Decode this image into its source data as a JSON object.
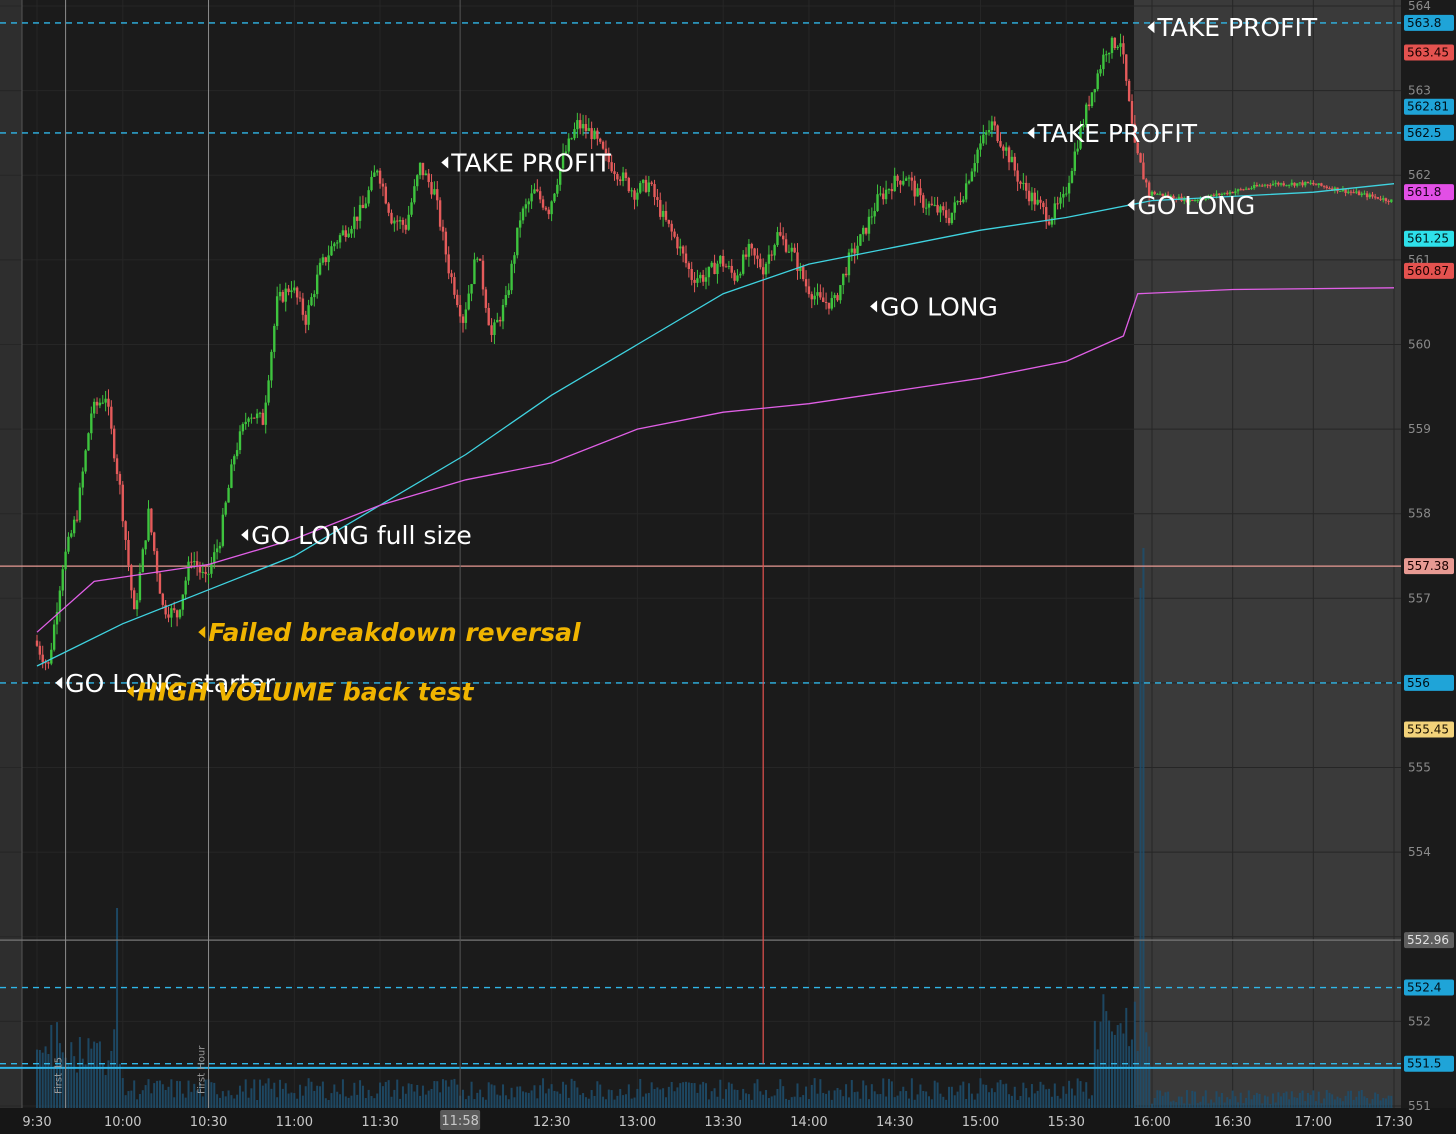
{
  "chart_data": {
    "type": "candlestick",
    "ylim": [
      551,
      564
    ],
    "y_ticks": [
      551,
      552,
      553,
      554,
      555,
      556,
      557,
      558,
      559,
      560,
      561,
      562,
      563,
      564
    ],
    "x_tick_labels": [
      "9:30",
      "10:00",
      "10:30",
      "11:00",
      "11:30",
      "12:30",
      "13:00",
      "13:30",
      "14:00",
      "14:30",
      "15:00",
      "15:30",
      "16:00",
      "16:30",
      "17:00",
      "17:30"
    ],
    "cursor_time_label": "11:58",
    "price_levels": [
      {
        "value": 563.8,
        "label": "563.8",
        "style": "dashed",
        "color": "#2fb6e8"
      },
      {
        "value": 562.5,
        "label": "562.5",
        "style": "dashed",
        "color": "#2fb6e8"
      },
      {
        "value": 557.38,
        "label": "557.38",
        "style": "solid",
        "color": "#e79a93"
      },
      {
        "value": 556,
        "label": "556",
        "style": "dashed",
        "color": "#2fb6e8"
      },
      {
        "value": 552.96,
        "label": "552.96",
        "style": "solid",
        "color": "#777777"
      },
      {
        "value": 552.4,
        "label": "552.4",
        "style": "dashed",
        "color": "#2fb6e8"
      },
      {
        "value": 551.5,
        "label": "551.5",
        "style": "dashed",
        "color": "#2fb6e8"
      }
    ],
    "price_badges": [
      {
        "value": 563.8,
        "label": "563.8",
        "bg": "#1fa4d8",
        "fg": "#001018"
      },
      {
        "value": 563.45,
        "label": "563.45",
        "bg": "#e4524f",
        "fg": "#1a0000"
      },
      {
        "value": 562.81,
        "label": "562.81",
        "bg": "#1fa4d8",
        "fg": "#001018"
      },
      {
        "value": 562.5,
        "label": "562.5",
        "bg": "#1fa4d8",
        "fg": "#001018"
      },
      {
        "value": 561.8,
        "label": "561.8",
        "bg": "#e24fe6",
        "fg": "#1a001a"
      },
      {
        "value": 561.25,
        "label": "561.25",
        "bg": "#2ee0ea",
        "fg": "#00181a"
      },
      {
        "value": 560.87,
        "label": "560.87",
        "bg": "#e4524f",
        "fg": "#1a0000"
      },
      {
        "value": 557.38,
        "label": "557.38",
        "bg": "#e79a93",
        "fg": "#1a0000"
      },
      {
        "value": 556,
        "label": "556",
        "bg": "#1fa4d8",
        "fg": "#001018"
      },
      {
        "value": 555.45,
        "label": "555.45",
        "bg": "#f2d27a",
        "fg": "#1a1000"
      },
      {
        "value": 552.96,
        "label": "552.96",
        "bg": "#5e5e5e",
        "fg": "#e0e0e0"
      },
      {
        "value": 552.4,
        "label": "552.4",
        "bg": "#1fa4d8",
        "fg": "#001018"
      },
      {
        "value": 551.5,
        "label": "551.5",
        "bg": "#1fa4d8",
        "fg": "#001018"
      }
    ],
    "price_path": [
      [
        "9:30",
        556.5
      ],
      [
        "9:35",
        556.2
      ],
      [
        "9:40",
        557.4
      ],
      [
        "9:45",
        558.0
      ],
      [
        "9:50",
        559.2
      ],
      [
        "9:55",
        559.4
      ],
      [
        "10:00",
        558.3
      ],
      [
        "10:05",
        556.8
      ],
      [
        "10:10",
        558.0
      ],
      [
        "10:15",
        556.9
      ],
      [
        "10:20",
        556.8
      ],
      [
        "10:25",
        557.5
      ],
      [
        "10:30",
        557.2
      ],
      [
        "10:35",
        557.7
      ],
      [
        "10:40",
        558.7
      ],
      [
        "10:45",
        559.2
      ],
      [
        "10:50",
        559.1
      ],
      [
        "10:55",
        560.5
      ],
      [
        "11:00",
        560.7
      ],
      [
        "11:05",
        560.3
      ],
      [
        "11:10",
        560.9
      ],
      [
        "11:15",
        561.2
      ],
      [
        "11:20",
        561.4
      ],
      [
        "11:25",
        561.6
      ],
      [
        "11:30",
        562.1
      ],
      [
        "11:35",
        561.5
      ],
      [
        "11:40",
        561.4
      ],
      [
        "11:45",
        562.1
      ],
      [
        "11:50",
        561.8
      ],
      [
        "11:55",
        560.9
      ],
      [
        "12:00",
        560.3
      ],
      [
        "12:05",
        561.1
      ],
      [
        "12:10",
        560.1
      ],
      [
        "12:15",
        560.5
      ],
      [
        "12:20",
        561.5
      ],
      [
        "12:25",
        561.8
      ],
      [
        "12:30",
        561.6
      ],
      [
        "12:35",
        562.2
      ],
      [
        "12:40",
        562.6
      ],
      [
        "12:45",
        562.5
      ],
      [
        "12:50",
        562.2
      ],
      [
        "12:55",
        562.0
      ],
      [
        "13:00",
        561.8
      ],
      [
        "13:05",
        561.9
      ],
      [
        "13:10",
        561.5
      ],
      [
        "13:15",
        561.2
      ],
      [
        "13:20",
        560.8
      ],
      [
        "13:25",
        560.8
      ],
      [
        "13:30",
        561.0
      ],
      [
        "13:35",
        560.8
      ],
      [
        "13:40",
        561.1
      ],
      [
        "13:45",
        560.9
      ],
      [
        "13:50",
        561.3
      ],
      [
        "13:55",
        561.1
      ],
      [
        "14:00",
        560.7
      ],
      [
        "14:05",
        560.5
      ],
      [
        "14:10",
        560.5
      ],
      [
        "14:15",
        561.0
      ],
      [
        "14:20",
        561.3
      ],
      [
        "14:25",
        561.7
      ],
      [
        "14:30",
        561.9
      ],
      [
        "14:35",
        562.0
      ],
      [
        "14:40",
        561.7
      ],
      [
        "14:45",
        561.6
      ],
      [
        "14:50",
        561.5
      ],
      [
        "14:55",
        561.8
      ],
      [
        "15:00",
        562.3
      ],
      [
        "15:05",
        562.6
      ],
      [
        "15:10",
        562.3
      ],
      [
        "15:15",
        561.9
      ],
      [
        "15:20",
        561.7
      ],
      [
        "15:25",
        561.5
      ],
      [
        "15:30",
        561.7
      ],
      [
        "15:35",
        562.4
      ],
      [
        "15:40",
        563.0
      ],
      [
        "15:45",
        563.5
      ],
      [
        "15:50",
        563.6
      ],
      [
        "15:55",
        562.3
      ],
      [
        "16:00",
        561.8
      ],
      [
        "16:15",
        561.7
      ],
      [
        "16:30",
        561.8
      ],
      [
        "16:45",
        561.9
      ],
      [
        "17:00",
        561.9
      ],
      [
        "17:15",
        561.8
      ],
      [
        "17:30",
        561.7
      ]
    ],
    "moving_average_cyan": [
      [
        "9:30",
        556.2
      ],
      [
        "10:00",
        556.7
      ],
      [
        "10:30",
        557.1
      ],
      [
        "11:00",
        557.5
      ],
      [
        "11:30",
        558.1
      ],
      [
        "12:00",
        558.7
      ],
      [
        "12:30",
        559.4
      ],
      [
        "13:00",
        560.0
      ],
      [
        "13:30",
        560.6
      ],
      [
        "14:00",
        560.95
      ],
      [
        "14:30",
        561.15
      ],
      [
        "15:00",
        561.35
      ],
      [
        "15:30",
        561.5
      ],
      [
        "16:00",
        561.7
      ],
      [
        "16:30",
        561.75
      ],
      [
        "17:00",
        561.8
      ],
      [
        "17:30",
        561.9
      ]
    ],
    "vwap_magenta": [
      [
        "9:30",
        556.6
      ],
      [
        "9:50",
        557.2
      ],
      [
        "10:10",
        557.3
      ],
      [
        "10:30",
        557.4
      ],
      [
        "11:00",
        557.7
      ],
      [
        "11:30",
        558.1
      ],
      [
        "12:00",
        558.4
      ],
      [
        "12:30",
        558.6
      ],
      [
        "13:00",
        559.0
      ],
      [
        "13:30",
        559.2
      ],
      [
        "14:00",
        559.3
      ],
      [
        "14:30",
        559.45
      ],
      [
        "15:00",
        559.6
      ],
      [
        "15:30",
        559.8
      ],
      [
        "15:50",
        560.1
      ],
      [
        "15:55",
        560.6
      ],
      [
        "16:30",
        560.65
      ],
      [
        "17:30",
        560.67
      ]
    ],
    "annotations": [
      {
        "text": "GO LONG starter",
        "color": "white",
        "time": "9:35",
        "price": 556.0
      },
      {
        "text": "HIGH VOLUME back test",
        "color": "gold",
        "time": "10:00",
        "price": 555.9
      },
      {
        "text": "Failed breakdown reversal",
        "color": "gold",
        "time": "10:25",
        "price": 556.6
      },
      {
        "text": "GO LONG full size",
        "color": "white",
        "time": "10:40",
        "price": 557.75
      },
      {
        "text": "TAKE PROFIT",
        "color": "white",
        "time": "11:50",
        "price": 562.15
      },
      {
        "text": "GO LONG",
        "color": "white",
        "time": "14:20",
        "price": 560.45
      },
      {
        "text": "TAKE PROFIT",
        "color": "white",
        "time": "15:15",
        "price": 562.5
      },
      {
        "text": "GO LONG",
        "color": "white",
        "time": "15:50",
        "price": 561.65
      },
      {
        "text": "TAKE PROFIT",
        "color": "white",
        "time": "15:57",
        "price": 563.75
      }
    ],
    "vertical_markers": [
      {
        "time": "9:40",
        "label": "First 15"
      },
      {
        "time": "10:30",
        "label": "First Hour"
      }
    ],
    "grid": true
  }
}
